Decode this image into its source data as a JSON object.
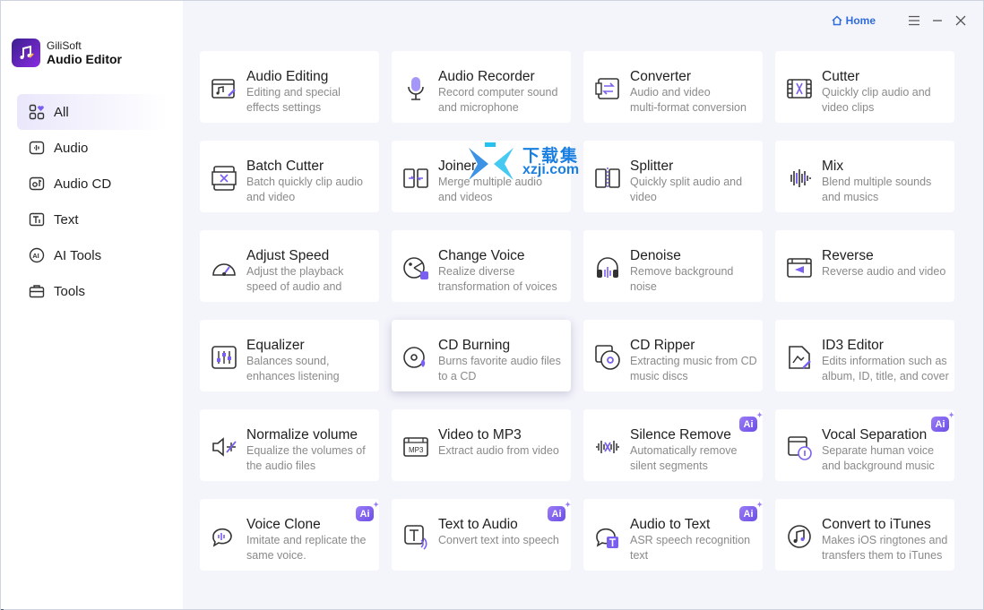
{
  "brand": {
    "sub": "GiliSoft",
    "main": "Audio Editor"
  },
  "topbar": {
    "home_label": "Home"
  },
  "sidebar": {
    "items": [
      {
        "label": "All",
        "icon": "grid-heart-icon",
        "active": true
      },
      {
        "label": "Audio",
        "icon": "audio-icon",
        "active": false
      },
      {
        "label": "Audio CD",
        "icon": "audio-cd-icon",
        "active": false
      },
      {
        "label": "Text",
        "icon": "text-icon",
        "active": false
      },
      {
        "label": "AI Tools",
        "icon": "ai-icon",
        "active": false
      },
      {
        "label": "Tools",
        "icon": "toolbox-icon",
        "active": false
      }
    ]
  },
  "tools": [
    {
      "title": "Audio Editing",
      "desc1": "Editing and special",
      "desc2": "effects settings",
      "icon": "audio-editing-icon",
      "ai": false
    },
    {
      "title": "Audio Recorder",
      "desc1": "Record computer sound",
      "desc2": "and microphone",
      "icon": "microphone-icon",
      "ai": false
    },
    {
      "title": "Converter",
      "desc1": "Audio and video",
      "desc2": "multi-format conversion",
      "icon": "converter-icon",
      "ai": false
    },
    {
      "title": "Cutter",
      "desc1": "Quickly clip audio and",
      "desc2": "video clips",
      "icon": "cutter-icon",
      "ai": false
    },
    {
      "title": "Batch Cutter",
      "desc1": "Batch quickly clip audio",
      "desc2": "and video",
      "icon": "batch-cutter-icon",
      "ai": false
    },
    {
      "title": "Joiner",
      "desc1": "Merge multiple audio",
      "desc2": "and videos",
      "icon": "joiner-icon",
      "ai": false
    },
    {
      "title": "Splitter",
      "desc1": "Quickly split audio and",
      "desc2": "video",
      "icon": "splitter-icon",
      "ai": false
    },
    {
      "title": "Mix",
      "desc1": "Blend multiple sounds",
      "desc2": "and musics",
      "icon": "mix-icon",
      "ai": false
    },
    {
      "title": "Adjust Speed",
      "desc1": "Adjust the playback",
      "desc2": "speed of audio and",
      "icon": "speedometer-icon",
      "ai": false
    },
    {
      "title": "Change Voice",
      "desc1": "Realize diverse",
      "desc2": "transformation of voices",
      "icon": "change-voice-icon",
      "ai": false
    },
    {
      "title": "Denoise",
      "desc1": "Remove background",
      "desc2": "noise",
      "icon": "headphones-icon",
      "ai": false
    },
    {
      "title": "Reverse",
      "desc1": "Reverse audio and video",
      "desc2": "",
      "icon": "reverse-icon",
      "ai": false
    },
    {
      "title": "Equalizer",
      "desc1": "Balances sound,",
      "desc2": "enhances listening",
      "icon": "equalizer-icon",
      "ai": false
    },
    {
      "title": "CD Burning",
      "desc1": "Burns favorite audio files",
      "desc2": "to a CD",
      "icon": "cd-burning-icon",
      "ai": false
    },
    {
      "title": "CD Ripper",
      "desc1": "Extracting music from CD",
      "desc2": "music discs",
      "icon": "cd-ripper-icon",
      "ai": false
    },
    {
      "title": "ID3 Editor",
      "desc1": "Edits information such as",
      "desc2": "album, ID, title, and cover",
      "icon": "id3-editor-icon",
      "ai": false
    },
    {
      "title": "Normalize volume",
      "desc1": "Equalize the volumes of",
      "desc2": "the audio files",
      "icon": "normalize-icon",
      "ai": false
    },
    {
      "title": "Video to MP3",
      "desc1": "Extract audio from video",
      "desc2": "",
      "icon": "mp3-icon",
      "ai": false
    },
    {
      "title": "Silence Remove",
      "desc1": "Automatically remove",
      "desc2": "silent segments",
      "icon": "silence-remove-icon",
      "ai": true
    },
    {
      "title": "Vocal Separation",
      "desc1": "Separate human voice",
      "desc2": "and background music",
      "icon": "vocal-separation-icon",
      "ai": true
    },
    {
      "title": "Voice Clone",
      "desc1": "Imitate and replicate the",
      "desc2": "same voice.",
      "icon": "voice-clone-icon",
      "ai": true
    },
    {
      "title": "Text to Audio",
      "desc1": "Convert text into speech",
      "desc2": "",
      "icon": "text-to-audio-icon",
      "ai": true
    },
    {
      "title": "Audio to Text",
      "desc1": "ASR speech recognition",
      "desc2": "text",
      "icon": "audio-to-text-icon",
      "ai": true
    },
    {
      "title": "Convert to iTunes",
      "desc1": "Makes iOS ringtones and",
      "desc2": "transfers them to iTunes",
      "icon": "itunes-icon",
      "ai": false
    }
  ],
  "ai_badge_label": "Ai",
  "watermark": {
    "text": "下载集",
    "url": "xzji.com"
  },
  "colors": {
    "accent": "#6b4ee6",
    "home": "#2f6bd9",
    "background": "#f4f4fb"
  }
}
